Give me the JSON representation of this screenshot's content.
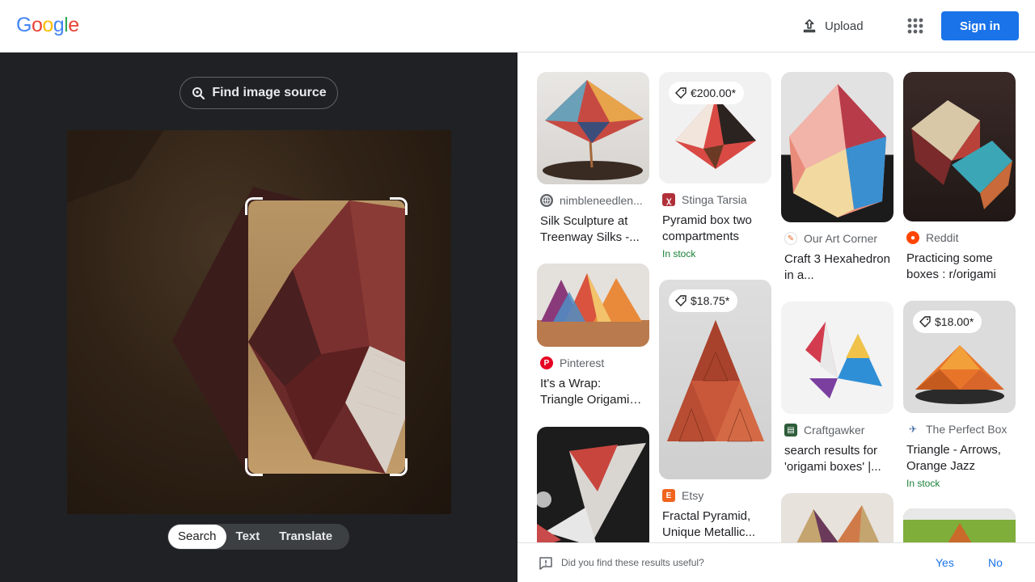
{
  "header": {
    "logo_letters": [
      "G",
      "o",
      "o",
      "g",
      "l",
      "e"
    ],
    "upload_label": "Upload",
    "signin_label": "Sign in"
  },
  "left": {
    "find_source_label": "Find image source",
    "modes": [
      {
        "label": "Search",
        "active": true
      },
      {
        "label": "Text",
        "active": false
      },
      {
        "label": "Translate",
        "active": false
      }
    ]
  },
  "results": [
    {
      "site": "nimbleneedlen...",
      "title": "Silk Sculpture at Treenway Silks -...",
      "price": "",
      "stock": "",
      "fav_icon": "globe-icon"
    },
    {
      "site": "Stinga Tarsia",
      "title": "Pyramid box two compartments",
      "price": "€200.00*",
      "stock": "In stock",
      "fav_icon": "stinga-icon"
    },
    {
      "site": "Our Art Corner",
      "title": "Craft 3 Hexahedron in a...",
      "price": "",
      "stock": "",
      "fav_icon": "art-corner-icon"
    },
    {
      "site": "Reddit",
      "title": "Practicing some boxes : r/origami",
      "price": "",
      "stock": "",
      "fav_icon": "reddit-icon"
    },
    {
      "site": "Pinterest",
      "title": "It's a Wrap: Triangle Origami Boxes | I...",
      "price": "",
      "stock": "",
      "fav_icon": "pinterest-icon"
    },
    {
      "site": "Etsy",
      "title": "Fractal Pyramid, Unique Metallic...",
      "price": "$18.75*",
      "stock": "",
      "fav_icon": "etsy-icon"
    },
    {
      "site": "Craftgawker",
      "title": "search results for 'origami boxes' |...",
      "price": "",
      "stock": "",
      "fav_icon": "craftgawker-icon"
    },
    {
      "site": "The Perfect Box",
      "title": "Triangle - Arrows, Orange Jazz",
      "price": "$18.00*",
      "stock": "In stock",
      "fav_icon": "perfect-box-icon"
    }
  ],
  "feedback": {
    "question": "Did you find these results useful?",
    "yes": "Yes",
    "no": "No"
  },
  "colors": {
    "accent": "#1a73e8",
    "dark_panel": "#202124",
    "stock_green": "#188038"
  }
}
